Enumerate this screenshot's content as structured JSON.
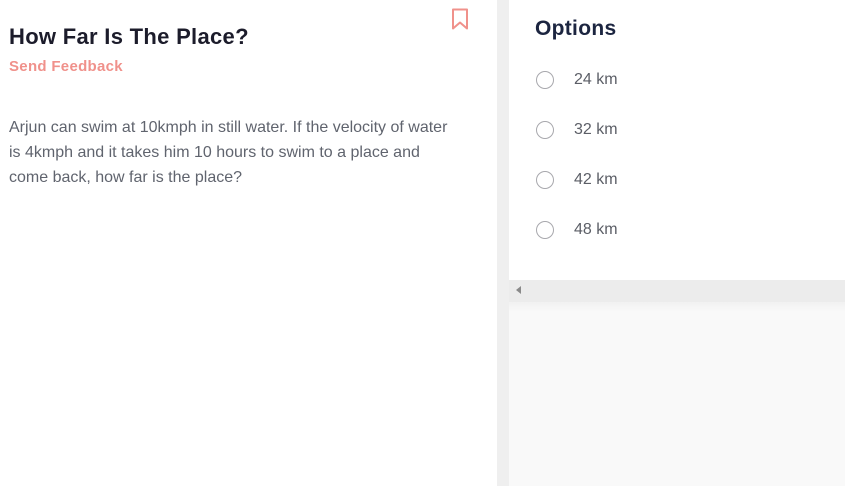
{
  "question": {
    "title": "How Far Is The Place?",
    "feedback_label": "Send Feedback",
    "text": "Arjun can swim at 10kmph in still water. If the velocity of water is 4kmph and it takes him 10 hours to swim to a place and come back, how far is the place?"
  },
  "options": {
    "heading": "Options",
    "items": [
      {
        "label": "24 km"
      },
      {
        "label": "32 km"
      },
      {
        "label": "42 km"
      },
      {
        "label": "48 km"
      }
    ]
  },
  "icons": {
    "bookmark": "bookmark-icon",
    "radio": "radio-unchecked-icon",
    "scroll_left": "scroll-left-arrow-icon"
  },
  "colors": {
    "accent": "#f0918b",
    "title": "#1c1c2b",
    "body_text": "#60646e",
    "divider": "#efefef"
  }
}
